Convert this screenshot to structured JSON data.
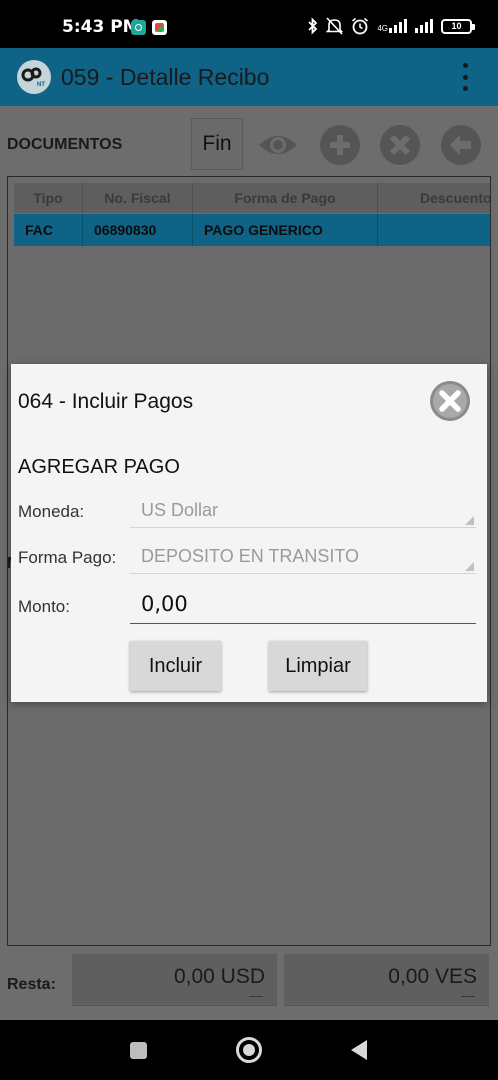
{
  "status_bar": {
    "time": "5:43 PM",
    "network": "4G",
    "battery": "10"
  },
  "app_bar": {
    "title": "059 - Detalle Recibo",
    "logo_text": "NT"
  },
  "toolbar": {
    "section_label": "DOCUMENTOS",
    "fin_label": "Fin",
    "icons": [
      "eye-icon",
      "add-icon",
      "delete-icon",
      "back-arrow-icon"
    ]
  },
  "table": {
    "columns": [
      "Tipo",
      "No. Fiscal",
      "Forma de Pago",
      "Descuento"
    ],
    "rows": [
      [
        "FAC",
        "06890830",
        "PAGO GENERICO",
        ""
      ]
    ]
  },
  "side_fragment": "M",
  "totals": {
    "label": "Resta:",
    "usd": "0,00 USD",
    "ves": "0,00 VES"
  },
  "dialog": {
    "title": "064 - Incluir Pagos",
    "section": "AGREGAR PAGO",
    "moneda_label": "Moneda:",
    "moneda_value": "US Dollar",
    "forma_label": "Forma Pago:",
    "forma_value": "DEPOSITO EN TRANSITO",
    "monto_label": "Monto:",
    "monto_value": "0,00",
    "incluir_label": "Incluir",
    "limpiar_label": "Limpiar"
  },
  "colors": {
    "accent": "#0e6387",
    "dialog_bg": "#f4f4f4",
    "dimmed_bg": "#6d6d6d"
  }
}
